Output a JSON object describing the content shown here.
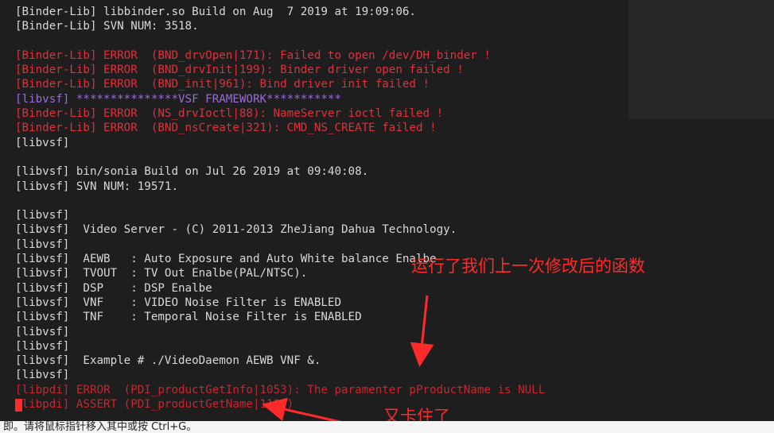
{
  "terminal": {
    "lines": [
      {
        "text": "[Binder-Lib] libbinder.so Build on Aug  7 2019 at 19:09:06.",
        "style": "normal"
      },
      {
        "text": "[Binder-Lib] SVN NUM: 3518.",
        "style": "normal"
      },
      {
        "text": "",
        "style": "normal"
      },
      {
        "text": "[Binder-Lib] ERROR  (BND_drvOpen|171): Failed to open /dev/DH_binder !",
        "style": "err"
      },
      {
        "text": "[Binder-Lib] ERROR  (BND_drvInit|199): Binder driver open failed !",
        "style": "err"
      },
      {
        "text": "[Binder-Lib] ERROR  (BND_init|961): Bind driver init failed !",
        "style": "err"
      },
      {
        "text": "[libvsf] ***************VSF FRAMEWORK***********",
        "style": "vsf"
      },
      {
        "text": "[Binder-Lib] ERROR  (NS_drvIoctl|88): NameServer ioctl failed !",
        "style": "err"
      },
      {
        "text": "[Binder-Lib] ERROR  (BND_nsCreate|321): CMD_NS_CREATE failed !",
        "style": "err"
      },
      {
        "text": "[libvsf]",
        "style": "normal"
      },
      {
        "text": "",
        "style": "normal"
      },
      {
        "text": "[libvsf] bin/sonia Build on Jul 26 2019 at 09:40:08.",
        "style": "normal"
      },
      {
        "text": "[libvsf] SVN NUM: 19571.",
        "style": "normal"
      },
      {
        "text": "",
        "style": "normal"
      },
      {
        "text": "[libvsf]",
        "style": "normal"
      },
      {
        "text": "[libvsf]  Video Server - (C) 2011-2013 ZheJiang Dahua Technology.",
        "style": "normal"
      },
      {
        "text": "[libvsf]",
        "style": "normal"
      },
      {
        "text": "[libvsf]  AEWB   : Auto Exposure and Auto White balance Enalbe",
        "style": "normal"
      },
      {
        "text": "[libvsf]  TVOUT  : TV Out Enalbe(PAL/NTSC).",
        "style": "normal"
      },
      {
        "text": "[libvsf]  DSP    : DSP Enalbe",
        "style": "normal"
      },
      {
        "text": "[libvsf]  VNF    : VIDEO Noise Filter is ENABLED",
        "style": "normal"
      },
      {
        "text": "[libvsf]  TNF    : Temporal Noise Filter is ENABLED",
        "style": "normal"
      },
      {
        "text": "[libvsf]",
        "style": "normal"
      },
      {
        "text": "[libvsf]",
        "style": "normal"
      },
      {
        "text": "[libvsf]  Example # ./VideoDaemon AEWB VNF &.",
        "style": "normal"
      },
      {
        "text": "[libvsf]",
        "style": "normal"
      },
      {
        "text": "[libpdi] ERROR  (PDI_productGetInfo|1053): The paramenter pProductName is NULL",
        "style": "err-dim"
      },
      {
        "text": "[libpdi] ASSERT (PDI_productGetName|1104)",
        "style": "err-dim"
      }
    ]
  },
  "annotations": {
    "ran_modified_function": "运行了我们上一次修改后的函数",
    "stuck_again": "又卡住了"
  },
  "statusbar": {
    "text": "即。请将鼠标指针移入其中或按 Ctrl+G。"
  },
  "colors": {
    "error": "#e0303a",
    "vsf_banner": "#9a6bd6",
    "annotation": "#ff2a2a",
    "background": "#1e1e1e"
  }
}
